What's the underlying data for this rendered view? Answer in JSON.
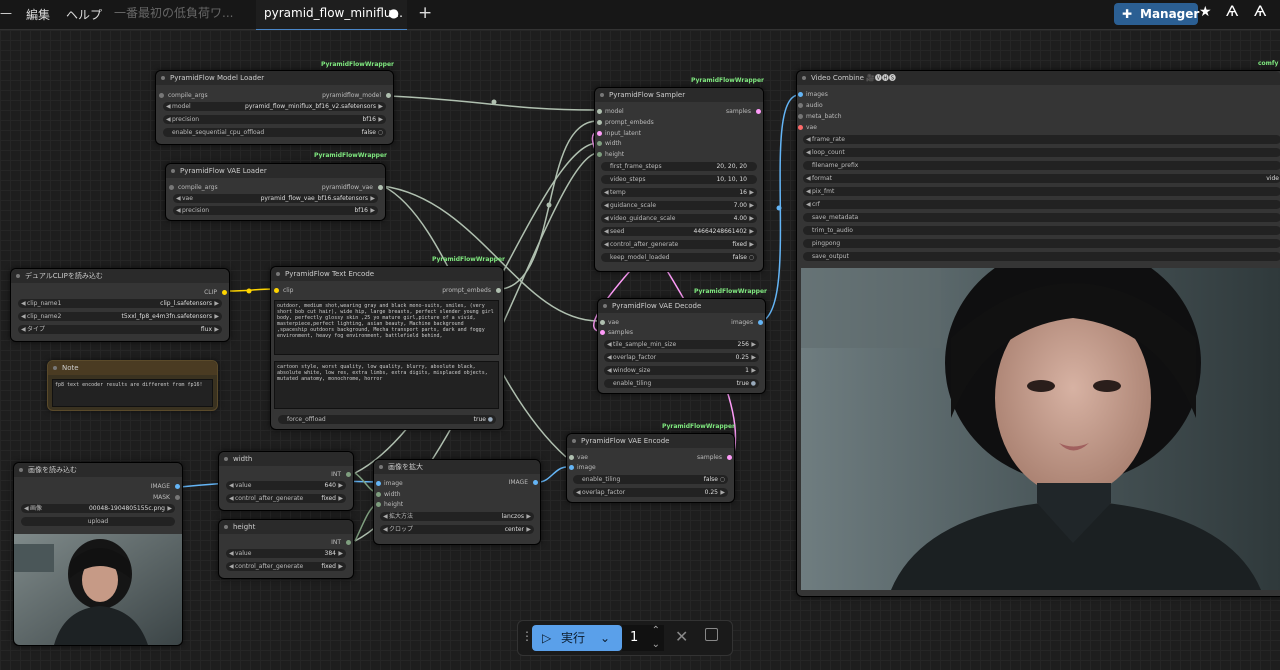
{
  "topbar": {
    "menu_edit": "編集",
    "menu_help": "ヘルプ",
    "tab_inactive": "一番最初の低負荷ワ...",
    "tab_active": "pyramid_flow_miniflu...",
    "add_tab": "+",
    "manager_label": "Manager"
  },
  "nodes": {
    "model_loader": {
      "badge": "PyramidFlowWrapper",
      "title": "PyramidFlow Model Loader",
      "in_compile": "compile_args",
      "out": "pyramidflow_model",
      "widgets": [
        {
          "label": "model",
          "value": "pyramid_flow_miniflux_bf16_v2.safetensors"
        },
        {
          "label": "precision",
          "value": "bf16"
        },
        {
          "label": "enable_sequential_cpu_offload",
          "value": "false"
        }
      ]
    },
    "vae_loader": {
      "badge": "PyramidFlowWrapper",
      "title": "PyramidFlow VAE Loader",
      "in_compile": "compile_args",
      "out": "pyramidflow_vae",
      "widgets": [
        {
          "label": "vae",
          "value": "pyramid_flow_vae_bf16.safetensors"
        },
        {
          "label": "precision",
          "value": "bf16"
        }
      ]
    },
    "dual_clip": {
      "title": "デュアルCLIPを読み込む",
      "out": "CLIP",
      "widgets": [
        {
          "label": "clip_name1",
          "value": "clip_l.safetensors"
        },
        {
          "label": "clip_name2",
          "value": "t5xxl_fp8_e4m3fn.safetensors"
        },
        {
          "label": "タイプ",
          "value": "flux"
        }
      ]
    },
    "note": {
      "title": "Note",
      "text": "fp8 text encoder results are different from fp16!"
    },
    "text_encode": {
      "badge": "PyramidFlowWrapper",
      "title": "PyramidFlow Text Encode",
      "in_clip": "clip",
      "out": "prompt_embeds",
      "positive": "outdoor, medium shot,wearing gray and black mono-suits, smiles, (very short bob cut hair), wide hip, large breasts, perfect slender young girl body, perfectly glossy skin ,25 yo mature girl,picture of a vivid, masterpiece,perfect lighting, asian beauty, Machine background ,spaceship outdoors background, Mecha transport parts, dark and foggy environment, heavy fog environment, battlefield behind,",
      "negative": "cartoon style, worst quality, low quality, blurry, absolute black, absolute white, low res, extra limbs, extra digits, misplaced objects, mutated anatomy, monochrome, horror",
      "toggle_label": "force_offload",
      "toggle_value": "true"
    },
    "sampler": {
      "badge": "PyramidFlowWrapper",
      "title": "PyramidFlow Sampler",
      "inputs": [
        "model",
        "prompt_embeds",
        "input_latent",
        "width",
        "height"
      ],
      "out": "samples",
      "widgets": [
        {
          "label": "first_frame_steps",
          "value": "20, 20, 20"
        },
        {
          "label": "video_steps",
          "value": "10, 10, 10"
        },
        {
          "label": "temp",
          "value": "16"
        },
        {
          "label": "guidance_scale",
          "value": "7.00"
        },
        {
          "label": "video_guidance_scale",
          "value": "4.00"
        },
        {
          "label": "seed",
          "value": "446642486​61402"
        },
        {
          "label": "control_after_generate",
          "value": "fixed"
        },
        {
          "label": "keep_model_loaded",
          "value": "false"
        }
      ]
    },
    "vae_decode": {
      "badge": "PyramidFlowWrapper",
      "title": "PyramidFlow VAE Decode",
      "inputs": [
        "vae",
        "samples"
      ],
      "out": "images",
      "widgets": [
        {
          "label": "tile_sample_min_size",
          "value": "256"
        },
        {
          "label": "overlap_factor",
          "value": "0.25"
        },
        {
          "label": "window_size",
          "value": "1"
        },
        {
          "label": "enable_tiling",
          "value": "true"
        }
      ]
    },
    "vae_encode": {
      "badge": "PyramidFlowWrapper",
      "title": "PyramidFlow VAE Encode",
      "inputs": [
        "vae",
        "image"
      ],
      "out": "samples",
      "widgets": [
        {
          "label": "enable_tiling",
          "value": "false"
        },
        {
          "label": "overlap_factor",
          "value": "0.25"
        }
      ]
    },
    "video_combine": {
      "title": "Video Combine 🎥🅥🅗🅢",
      "badge": "comfy",
      "inputs": [
        "images",
        "audio",
        "meta_batch",
        "vae"
      ],
      "widgets": [
        "frame_rate",
        "loop_count",
        "filename_prefix",
        "format",
        "pix_fmt",
        "crf",
        "save_metadata",
        "trim_to_audio",
        "pingpong",
        "save_output"
      ],
      "format_value": "vide"
    },
    "load_image": {
      "title": "画像を読み込む",
      "out_image": "IMAGE",
      "out_mask": "MASK",
      "widget_label": "画像",
      "widget_value": "00048-1904805155c.png",
      "upload": "upload"
    },
    "width": {
      "title": "width",
      "out": "INT",
      "widgets": [
        {
          "label": "value",
          "value": "640"
        },
        {
          "label": "control_after_generate",
          "value": "fixed"
        }
      ]
    },
    "height": {
      "title": "height",
      "out": "INT",
      "widgets": [
        {
          "label": "value",
          "value": "384"
        },
        {
          "label": "control_after_generate",
          "value": "fixed"
        }
      ]
    },
    "upscale": {
      "title": "画像を拡大",
      "inputs": [
        "image",
        "width",
        "height"
      ],
      "out": "IMAGE",
      "widgets": [
        {
          "label": "拡大方法",
          "value": "lanczos"
        },
        {
          "label": "クロップ",
          "value": "center"
        }
      ]
    }
  },
  "runbar": {
    "run_label": "実行",
    "count": "1"
  },
  "colors": {
    "accent": "#4a86c7",
    "wire_model": "#b0c0b0",
    "wire_latent": "#ff9cf9",
    "wire_image": "#64b5f6",
    "wire_clip": "#ffd500",
    "wire_int": "#7f9f7f",
    "badge": "#7fe87f"
  }
}
